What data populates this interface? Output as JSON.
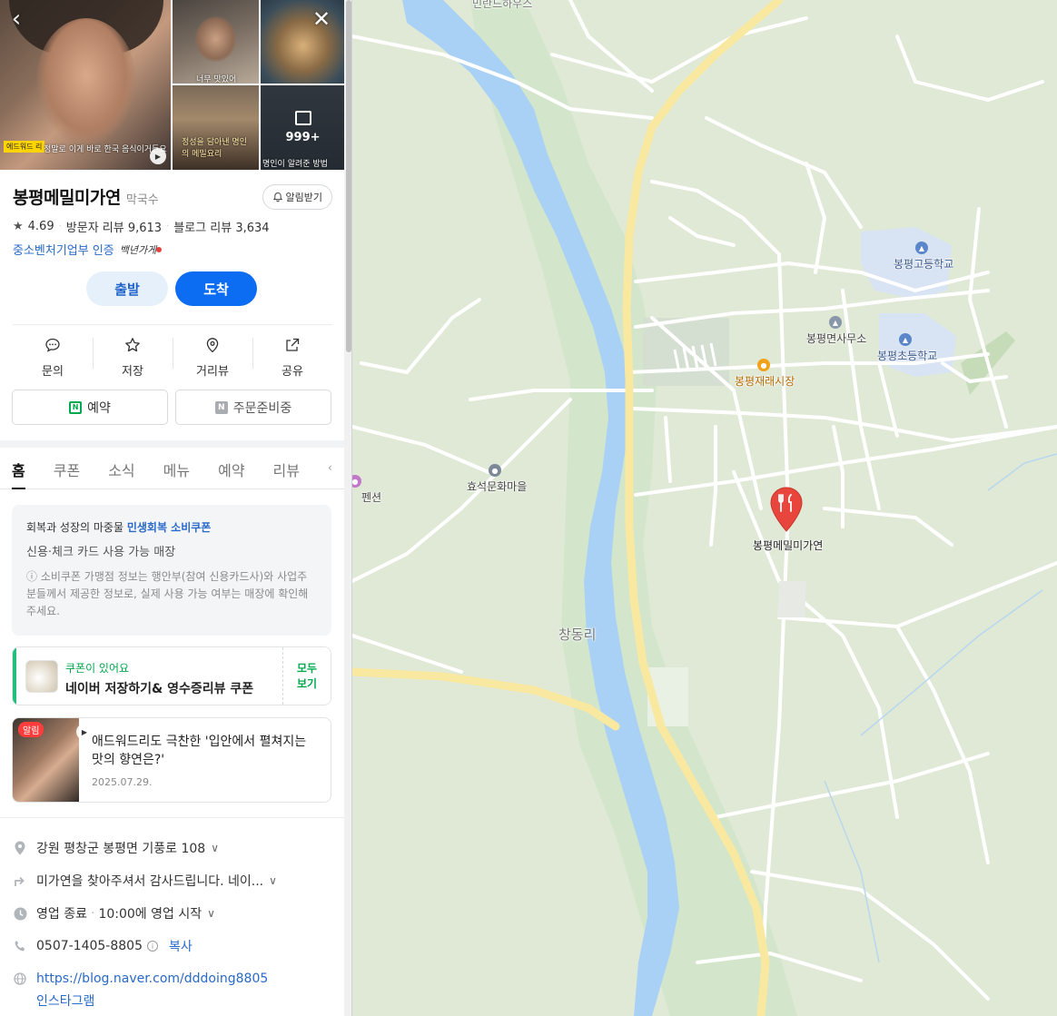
{
  "place": {
    "name": "봉평메밀미가연",
    "category": "막국수",
    "rating": "4.69",
    "visitor_reviews": "방문자 리뷰 9,613",
    "blog_reviews": "블로그 리뷰 3,634",
    "certification": "중소벤처기업부 인증",
    "certification_script": "백년가게",
    "alarm_label": "알림받기"
  },
  "photos": {
    "main_caption_tag": "에드워드 리",
    "main_caption": "정말로 이게 바로 한국 음식이거든요",
    "photo2_caption": "너무 맛있어",
    "photo4_caption": "정성을 담아낸 명인의 메밀요리",
    "more_count": "999+",
    "photo5_caption": "명인이 알려준 방법"
  },
  "route": {
    "depart": "출발",
    "arrive": "도착"
  },
  "actions": [
    {
      "label": "문의",
      "icon": "chat-bubble-icon"
    },
    {
      "label": "저장",
      "icon": "star-icon"
    },
    {
      "label": "거리뷰",
      "icon": "location-pin-icon"
    },
    {
      "label": "공유",
      "icon": "share-icon"
    }
  ],
  "booking": {
    "reserve": "예약",
    "order": "주문준비중"
  },
  "tabs": [
    "홈",
    "쿠폰",
    "소식",
    "메뉴",
    "예약",
    "리뷰"
  ],
  "notice": {
    "prefix": "회복과 성장의 마중물",
    "highlight": "민생회복 소비쿠폰",
    "subtitle": "신용·체크 카드 사용 가능 매장",
    "body": "ⓘ 소비쿠폰 가맹점 정보는 행안부(참여 신용카드사)와 사업주분들께서 제공한 정보로, 실제 사용 가능 여부는 매장에 확인해 주세요."
  },
  "coupon": {
    "label": "쿠폰이 있어요",
    "title": "네이버 저장하기& 영수증리뷰 쿠폰",
    "more_line1": "모두",
    "more_line2": "보기"
  },
  "news": {
    "badge": "알림",
    "title": "애드워드리도 극찬한 '입안에서 펼쳐지는 맛의 향연은?'",
    "date": "2025.07.29."
  },
  "details": {
    "address": "강원 평창군 봉평면 기풍로 108",
    "directions": "미가연을 찾아주셔서 감사드립니다. 네이...",
    "hours_status": "영업 종료",
    "hours_next": "10:00에 영업 시작",
    "phone": "0507-1405-8805",
    "copy_label": "복사",
    "website": "https://blog.naver.com/dddoing8805",
    "instagram": "인스타그램"
  },
  "map": {
    "labels": {
      "top": "민란드하우스",
      "high_school": "봉평고등학교",
      "office": "봉평면사무소",
      "elementary": "봉평초등학교",
      "market": "봉평재래시장",
      "culture_village": "효석문화마을",
      "pension": "펜션",
      "restaurant": "봉평메밀미가연",
      "district": "창동리"
    },
    "colors": {
      "land": "#dfe9d6",
      "water": "#a9d1f5",
      "road_major": "#f9e8a0",
      "road_minor": "#ffffff",
      "school_area": "#d8e3f3",
      "marker": "#e8463c"
    }
  }
}
